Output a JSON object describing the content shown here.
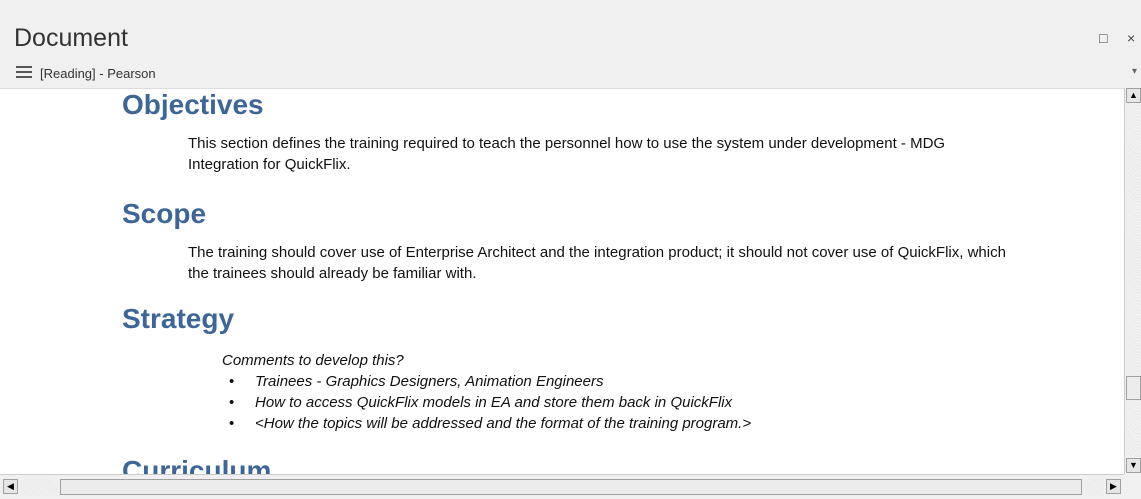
{
  "window": {
    "title": "Document",
    "maximize_glyph": "□",
    "close_glyph": "×"
  },
  "toolbar": {
    "menu_icon": "hamburger-menu-icon",
    "view_label": "[Reading] - Pearson",
    "dropdown_glyph": "▾"
  },
  "document": {
    "sections": [
      {
        "heading": "Objectives",
        "body": "This section defines the training required to teach the personnel how to use the system under development - MDG Integration for QuickFlix."
      },
      {
        "heading": "Scope",
        "body": "The training should cover use of Enterprise Architect and the integration product; it should not cover use of QuickFlix, which the trainees should already be familiar with."
      },
      {
        "heading": "Strategy",
        "intro": "Comments to develop this?",
        "bullets": [
          "Trainees - Graphics Designers, Animation Engineers",
          "How to access QuickFlix models in EA and store them back in QuickFlix",
          "<How the topics will be addressed and the format of the training program.>"
        ]
      },
      {
        "heading": "Curriculum"
      }
    ]
  },
  "scrollbars": {
    "up": "▲",
    "down": "▼",
    "left": "◀",
    "right": "▶"
  },
  "colors": {
    "heading": "#3d6597",
    "background": "#f0f0f0",
    "page": "#ffffff"
  }
}
